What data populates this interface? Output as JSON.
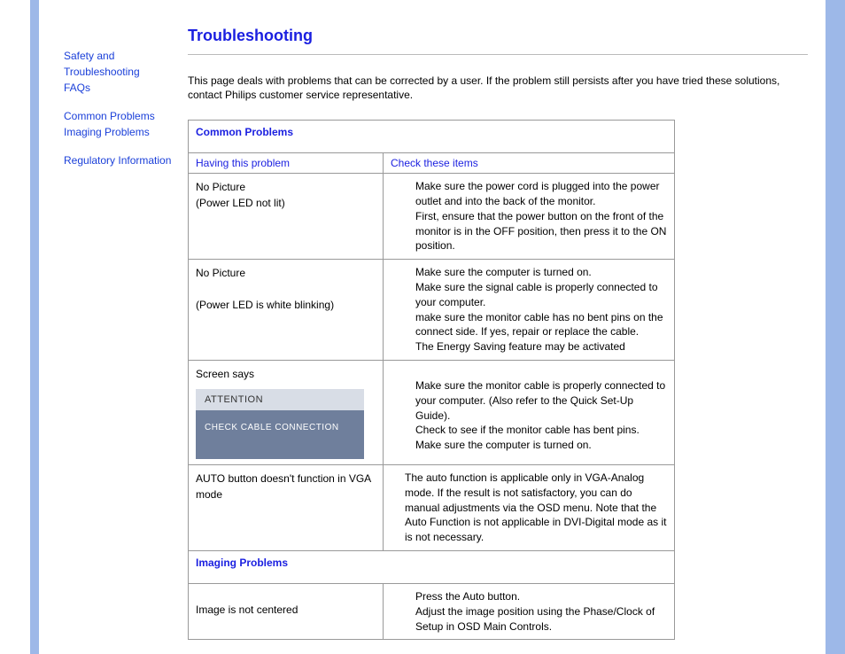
{
  "sidebar": {
    "links": [
      {
        "label": "Safety and Troubleshooting"
      },
      {
        "label": "FAQs"
      },
      {
        "label": "Common Problems"
      },
      {
        "label": "Imaging Problems"
      },
      {
        "label": "Regulatory Information"
      }
    ]
  },
  "page": {
    "title": "Troubleshooting",
    "intro": "This page deals with problems that can be corrected by a user. If the problem still persists after you have tried these solutions, contact Philips customer service representative."
  },
  "sections": {
    "common": {
      "heading": "Common Problems",
      "col_problem": "Having this problem",
      "col_check": "Check these items",
      "rows": [
        {
          "problem_1": "No Picture",
          "problem_2": "(Power LED not lit)",
          "solution": "Make sure the power cord is plugged into the power outlet and into the back of the monitor.\nFirst, ensure that the power button on the front of the monitor is in the OFF position, then press it to the ON position."
        },
        {
          "problem_1": "No Picture",
          "problem_2": "(Power LED is white blinking)",
          "solution": "Make sure the computer is turned on.\nMake sure the signal cable is properly connected to your computer.\nmake sure the monitor cable has no bent pins on the connect side. If yes, repair or replace the cable.\nThe Energy Saving feature may be activated"
        },
        {
          "problem_screensays": "Screen says",
          "attention_head": "ATTENTION",
          "attention_body": "CHECK CABLE CONNECTION",
          "solution": "Make sure the monitor cable is properly connected to your computer. (Also refer to the Quick Set-Up Guide).\nCheck to see if the monitor cable has bent pins.\nMake sure the computer is turned on."
        },
        {
          "problem_1": "AUTO button doesn't function in VGA mode",
          "solution": "The auto function is applicable only in VGA-Analog mode.  If the result is not satisfactory, you can do manual adjustments via the OSD menu.  Note that the Auto Function is not applicable in DVI-Digital mode as it is not necessary."
        }
      ]
    },
    "imaging": {
      "heading": "Imaging Problems",
      "rows": [
        {
          "problem_1": "Image is not centered",
          "solution": "Press the Auto button.\nAdjust the image position using the Phase/Clock of Setup in OSD Main Controls."
        }
      ]
    }
  }
}
